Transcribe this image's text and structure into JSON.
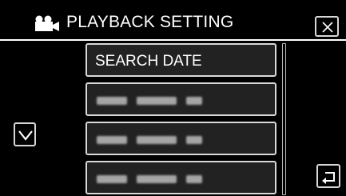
{
  "header": {
    "title": "PLAYBACK SETTING",
    "mode_icon": "video-camera-icon",
    "close_icon": "close-icon"
  },
  "menu": {
    "items": [
      {
        "label": "SEARCH DATE",
        "blurred": false
      },
      {
        "label": "",
        "blurred": true
      },
      {
        "label": "",
        "blurred": true
      },
      {
        "label": "",
        "blurred": true
      }
    ]
  },
  "controls": {
    "scroll_down_icon": "chevron-down-icon",
    "back_icon": "return-arrow-icon"
  },
  "colors": {
    "background": "#000000",
    "text": "#ffffff",
    "border": "#d8d8d8",
    "button_fill": "#222222"
  }
}
